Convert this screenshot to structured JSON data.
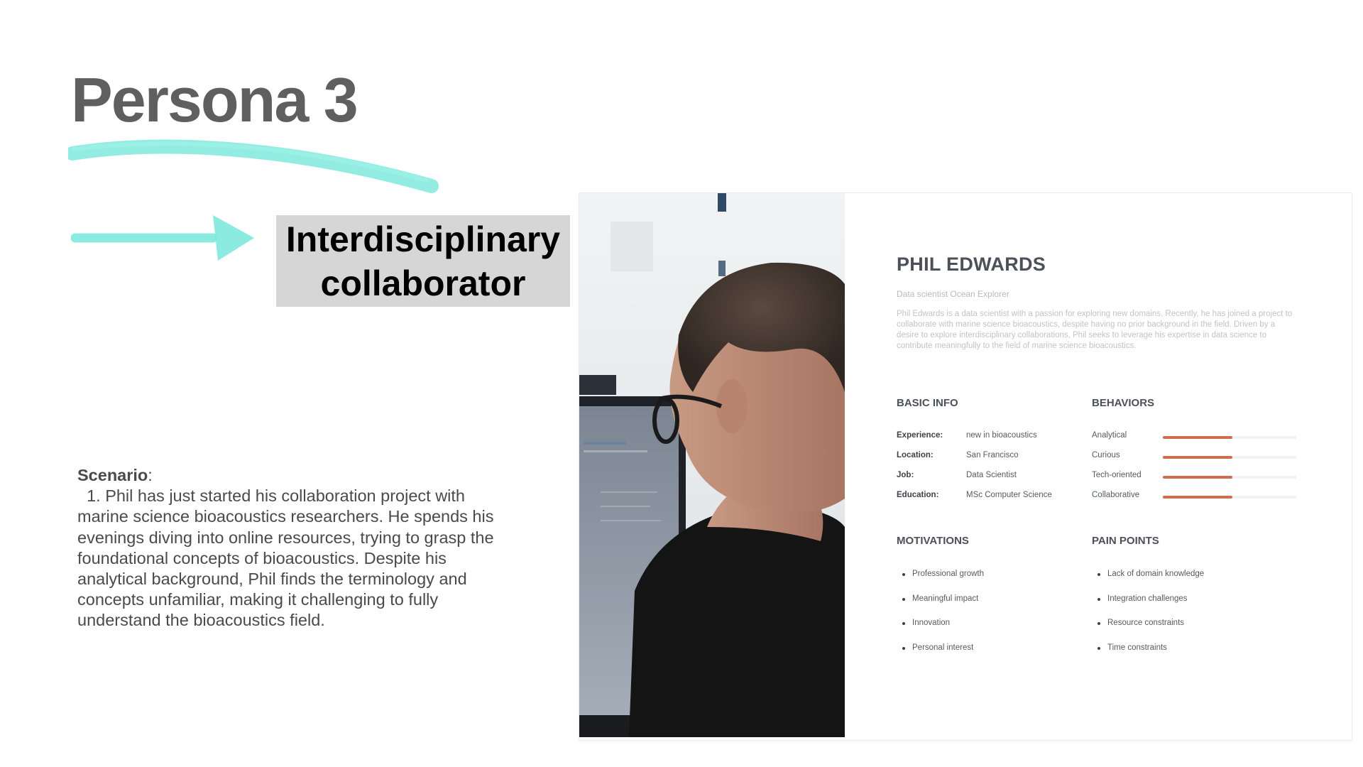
{
  "slide": {
    "title": "Persona 3",
    "tag": "Interdisciplinary collaborator",
    "accent_color": "#7fe9dd"
  },
  "scenario": {
    "label": "Scenario",
    "colon": ":",
    "text": "1. Phil has just started his collaboration project with marine science bioacoustics researchers. He spends his evenings diving into online resources, trying to grasp the foundational concepts of bioacoustics. Despite his analytical background, Phil finds the terminology and concepts unfamiliar, making it challenging to fully understand the bioacoustics field."
  },
  "persona": {
    "name": "PHIL EDWARDS",
    "role": "Data scientist Ocean Explorer",
    "bio": "Phil Edwards is a data scientist with a passion for exploring new domains. Recently, he has joined a project to collaborate with marine science bioacoustics, despite having no prior background in the field. Driven by a desire to explore interdisciplinary collaborations, Phil seeks to leverage his expertise in data science to contribute meaningfully to the field of marine science bioacoustics.",
    "basic_info": {
      "heading": "BASIC INFO",
      "rows": [
        {
          "key": "Experience:",
          "value": "new in bioacoustics"
        },
        {
          "key": "Location:",
          "value": "San Francisco"
        },
        {
          "key": "Job:",
          "value": "Data Scientist"
        },
        {
          "key": "Education:",
          "value": "MSc Computer Science"
        }
      ]
    },
    "behaviors": {
      "heading": "BEHAVIORS",
      "bar_color": "#cc6f4d",
      "items": [
        {
          "label": "Analytical",
          "level": 0.52
        },
        {
          "label": "Curious",
          "level": 0.52
        },
        {
          "label": "Tech-oriented",
          "level": 0.52
        },
        {
          "label": "Collaborative",
          "level": 0.52
        }
      ]
    },
    "motivations": {
      "heading": "MOTIVATIONS",
      "items": [
        "Professional growth",
        "Meaningful impact",
        "Innovation",
        "Personal interest"
      ]
    },
    "pain_points": {
      "heading": "PAIN POINTS",
      "items": [
        "Lack of domain knowledge",
        "Integration challenges",
        "Resource constraints",
        "Time constraints"
      ]
    }
  }
}
